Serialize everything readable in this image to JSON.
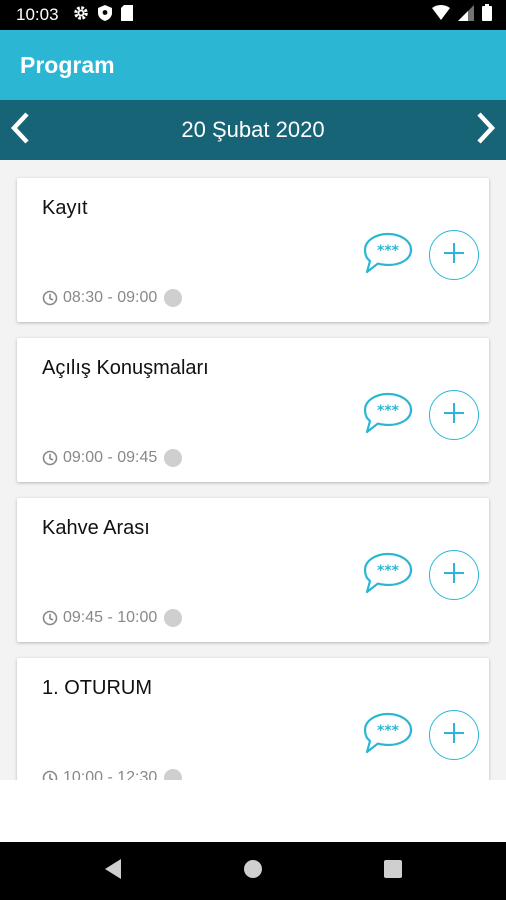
{
  "status_bar": {
    "time": "10:03",
    "left_icons": [
      "gear-icon",
      "shield-icon",
      "sd-card-icon"
    ],
    "right_icons": [
      "wifi-icon",
      "signal-icon",
      "battery-icon"
    ]
  },
  "app_bar": {
    "title": "Program"
  },
  "date_nav": {
    "date": "20 Şubat 2020",
    "prev_icon": "chevron-left-icon",
    "next_icon": "chevron-right-icon"
  },
  "sessions": [
    {
      "title": "Kayıt",
      "time": "08:30 - 09:00"
    },
    {
      "title": "Açılış Konuşmaları",
      "time": "09:00 - 09:45"
    },
    {
      "title": "Kahve Arası",
      "time": "09:45 - 10:00"
    },
    {
      "title": "1. OTURUM",
      "time": "10:00 - 12:30"
    }
  ],
  "colors": {
    "accent": "#2bb7d4",
    "date_bar": "#176477",
    "list_bg": "#f3f3f3",
    "status_dot": "#cfcfcf"
  }
}
